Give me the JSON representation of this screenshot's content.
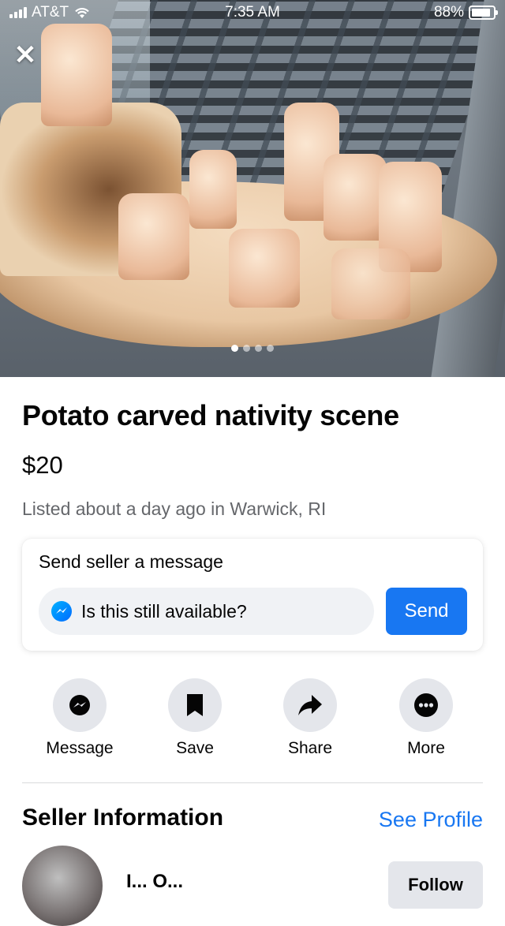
{
  "status_bar": {
    "carrier": "AT&T",
    "time": "7:35 AM",
    "battery": "88%"
  },
  "photo": {
    "alt": "Potato carved nativity scene",
    "page_count": 4,
    "current_page": 1
  },
  "listing": {
    "title": "Potato carved nativity scene",
    "price": "$20",
    "listed": "Listed about a day ago in Warwick, RI"
  },
  "message_card": {
    "label": "Send seller a message",
    "input_value": "Is this still available?",
    "send_label": "Send"
  },
  "actions": [
    {
      "label": "Message",
      "icon": "messenger-icon"
    },
    {
      "label": "Save",
      "icon": "bookmark-icon"
    },
    {
      "label": "Share",
      "icon": "share-arrow-icon"
    },
    {
      "label": "More",
      "icon": "more-dots-icon"
    }
  ],
  "seller": {
    "heading": "Seller Information",
    "see_profile": "See Profile",
    "name": "I... O...",
    "follow": "Follow"
  },
  "colors": {
    "accent": "#1877f2",
    "muted_text": "#65676b",
    "chip_bg": "#e4e6eb"
  }
}
